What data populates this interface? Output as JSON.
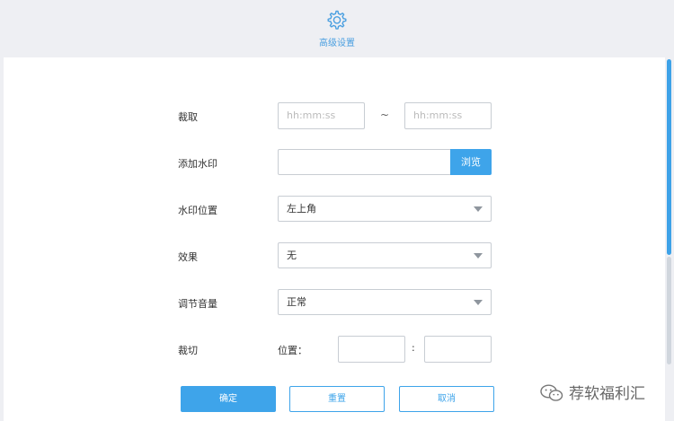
{
  "header": {
    "title": "高级设置",
    "icon": "gear-icon"
  },
  "form": {
    "trim": {
      "label": "裁取",
      "start_placeholder": "hh:mm:ss",
      "separator": "~",
      "end_placeholder": "hh:mm:ss"
    },
    "watermark": {
      "label": "添加水印",
      "value": "",
      "browse_label": "浏览"
    },
    "watermark_position": {
      "label": "水印位置",
      "selected": "左上角"
    },
    "effect": {
      "label": "效果",
      "selected": "无"
    },
    "volume": {
      "label": "调节音量",
      "selected": "正常"
    },
    "crop": {
      "label": "裁切",
      "position_label": "位置：",
      "separator": ":",
      "x_value": "",
      "y_value": ""
    }
  },
  "actions": {
    "confirm_label": "确定",
    "reset_label": "重置",
    "cancel_label": "取消"
  },
  "overlay_watermark": {
    "text": "荐软福利汇",
    "icon": "wechat-icon"
  },
  "colors": {
    "accent": "#3ea4ea",
    "header_bg": "#eeeff3"
  }
}
